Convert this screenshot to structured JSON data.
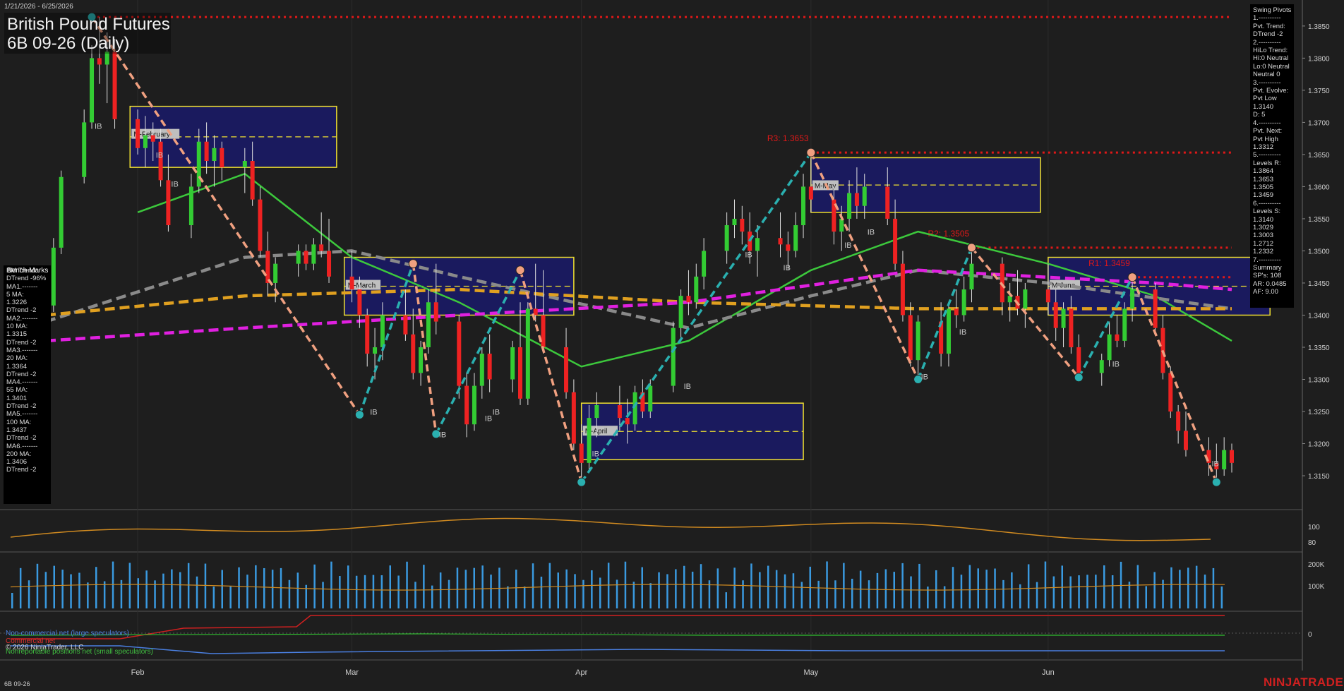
{
  "header": {
    "date_range": "1/21/2026 - 6/25/2026",
    "title_line1": "British Pound Futures",
    "title_line2": "6B 09-26 (Daily)"
  },
  "footer": {
    "symbol": "6B 09-26",
    "brand": "NINJATRADER",
    "copyright": "© 2026 NinjaTrader, LLC"
  },
  "swing_panel": [
    "Swing Pivots",
    "1.----------",
    "Pvt. Trend:",
    "DTrend -2",
    "2.----------",
    "HiLo Trend:",
    "Hi:0 Neutral",
    "Lo:0 Neutral",
    "Neutral 0",
    "3.----------",
    "Pvt. Evolve:",
    "Pvt Low",
    "1.3140",
    "D: 5",
    "4.----------",
    "Pvt. Next:",
    "Pvt High",
    "1.3312",
    "5.----------",
    "Levels R:",
    "1.3864",
    "1.3653",
    "1.3505",
    "1.3459",
    "6.----------",
    "Levels S:",
    "1.3140",
    "1.3029",
    "1.3003",
    "1.2712",
    "1.2332",
    "7.----------",
    "Summary",
    "SP's: 108",
    "AR: 0.0485",
    "AF: 9.00"
  ],
  "ma_panel": {
    "bench_label": "Bench Marks",
    "lines": [
      "BM Trend:",
      "DTrend -96%",
      "MA1.-------",
      "5 MA:",
      "1.3226",
      "DTrend -2",
      "MA2.-------",
      "10 MA:",
      "1.3315",
      "DTrend -2",
      "MA3.-------",
      "20 MA:",
      "1.3364",
      "DTrend -2",
      "MA4.-------",
      "55 MA:",
      "1.3401",
      "DTrend -2",
      "MA5.-------",
      "100 MA:",
      "1.3437",
      "DTrend -2",
      "MA6.-------",
      "200 MA:",
      "1.3406",
      "DTrend -2"
    ]
  },
  "legend": {
    "noncommercial": "Non-commercial net (large speculators)",
    "commercial": "Commercial net",
    "nonreportable": "Nonreportable positions net (small speculators)"
  },
  "colors": {
    "background": "#1e1e1e",
    "up_candle": "#33cc33",
    "down_candle": "#ee2222",
    "ma_green": "#3cc83c",
    "ma_gray": "#8a8a8a",
    "ma_orange": "#e0a020",
    "ma_magenta": "#e020e0",
    "swing_up": "#2ab0b0",
    "swing_down": "#f0a080",
    "resistance": "#e01818",
    "period_box": "#1a1a6a",
    "period_border": "#f0e030",
    "volume": "#3a9ae0",
    "oscillator": "#d08a20"
  },
  "chart_data": {
    "type": "candlestick",
    "y_axis_ticks": [
      "1.3850",
      "1.3800",
      "1.3750",
      "1.3700",
      "1.3650",
      "1.3600",
      "1.3550",
      "1.3500",
      "1.3450",
      "1.3400",
      "1.3350",
      "1.3300",
      "1.3250",
      "1.3200",
      "1.3150"
    ],
    "ylim": [
      1.3105,
      1.3885
    ],
    "x_tick_labels": [
      {
        "label": "Feb",
        "date": "2026-02-02"
      },
      {
        "label": "Mar",
        "date": "2026-03-02"
      },
      {
        "label": "Apr",
        "date": "2026-04-01"
      },
      {
        "label": "May",
        "date": "2026-05-01"
      },
      {
        "label": "Jun",
        "date": "2026-06-01"
      }
    ],
    "x_range": [
      "2026-01-21",
      "2026-06-25"
    ],
    "candles": [
      [
        "2026-01-21",
        1.337,
        1.3425,
        1.336,
        1.3415
      ],
      [
        "2026-01-22",
        1.3415,
        1.352,
        1.3405,
        1.3505
      ],
      [
        "2026-01-23",
        1.3505,
        1.3625,
        1.3495,
        1.3615
      ],
      [
        "2026-01-26",
        1.3615,
        1.372,
        1.3605,
        1.37
      ],
      [
        "2026-01-27",
        1.37,
        1.382,
        1.369,
        1.38
      ],
      [
        "2026-01-28",
        1.38,
        1.3864,
        1.376,
        1.379
      ],
      [
        "2026-01-29",
        1.379,
        1.384,
        1.373,
        1.381
      ],
      [
        "2026-01-30",
        1.381,
        1.383,
        1.369,
        1.3705
      ],
      [
        "2026-02-02",
        1.3705,
        1.372,
        1.365,
        1.366
      ],
      [
        "2026-02-03",
        1.366,
        1.371,
        1.363,
        1.368
      ],
      [
        "2026-02-04",
        1.368,
        1.37,
        1.364,
        1.367
      ],
      [
        "2026-02-05",
        1.367,
        1.369,
        1.36,
        1.361
      ],
      [
        "2026-02-06",
        1.361,
        1.365,
        1.353,
        1.354
      ],
      [
        "2026-02-09",
        1.354,
        1.362,
        1.352,
        1.36
      ],
      [
        "2026-02-10",
        1.36,
        1.369,
        1.359,
        1.367
      ],
      [
        "2026-02-11",
        1.367,
        1.37,
        1.362,
        1.364
      ],
      [
        "2026-02-12",
        1.364,
        1.368,
        1.36,
        1.366
      ],
      [
        "2026-02-13",
        1.366,
        1.367,
        1.361,
        1.363
      ],
      [
        "2026-02-16",
        1.363,
        1.366,
        1.359,
        1.364
      ],
      [
        "2026-02-17",
        1.364,
        1.367,
        1.357,
        1.358
      ],
      [
        "2026-02-18",
        1.358,
        1.36,
        1.349,
        1.35
      ],
      [
        "2026-02-19",
        1.35,
        1.353,
        1.343,
        1.345
      ],
      [
        "2026-02-20",
        1.345,
        1.349,
        1.342,
        1.348
      ],
      [
        "2026-02-23",
        1.348,
        1.351,
        1.346,
        1.35
      ],
      [
        "2026-02-24",
        1.35,
        1.351,
        1.347,
        1.348
      ],
      [
        "2026-02-25",
        1.348,
        1.352,
        1.347,
        1.351
      ],
      [
        "2026-02-26",
        1.351,
        1.356,
        1.349,
        1.35
      ],
      [
        "2026-02-27",
        1.35,
        1.355,
        1.345,
        1.346
      ],
      [
        "2026-03-02",
        1.346,
        1.35,
        1.342,
        1.344
      ],
      [
        "2026-03-03",
        1.344,
        1.346,
        1.338,
        1.34
      ],
      [
        "2026-03-04",
        1.34,
        1.341,
        1.332,
        1.334
      ],
      [
        "2026-03-05",
        1.334,
        1.338,
        1.33,
        1.335
      ],
      [
        "2026-03-06",
        1.335,
        1.342,
        1.333,
        1.34
      ],
      [
        "2026-03-09",
        1.34,
        1.344,
        1.336,
        1.337
      ],
      [
        "2026-03-10",
        1.337,
        1.341,
        1.33,
        1.331
      ],
      [
        "2026-03-11",
        1.331,
        1.336,
        1.329,
        1.335
      ],
      [
        "2026-03-12",
        1.335,
        1.344,
        1.334,
        1.342
      ],
      [
        "2026-03-13",
        1.342,
        1.348,
        1.337,
        1.339
      ],
      [
        "2026-03-16",
        1.339,
        1.34,
        1.327,
        1.329
      ],
      [
        "2026-03-17",
        1.329,
        1.331,
        1.321,
        1.323
      ],
      [
        "2026-03-18",
        1.323,
        1.331,
        1.322,
        1.329
      ],
      [
        "2026-03-19",
        1.329,
        1.335,
        1.327,
        1.334
      ],
      [
        "2026-03-20",
        1.334,
        1.337,
        1.328,
        1.33
      ],
      [
        "2026-03-23",
        1.33,
        1.336,
        1.328,
        1.335
      ],
      [
        "2026-03-24",
        1.335,
        1.342,
        1.326,
        1.327
      ],
      [
        "2026-03-25",
        1.327,
        1.342,
        1.326,
        1.341
      ],
      [
        "2026-03-26",
        1.341,
        1.348,
        1.339,
        1.34
      ],
      [
        "2026-03-27",
        1.34,
        1.347,
        1.334,
        1.335
      ],
      [
        "2026-03-30",
        1.335,
        1.338,
        1.327,
        1.328
      ],
      [
        "2026-03-31",
        1.328,
        1.33,
        1.319,
        1.32
      ],
      [
        "2026-04-01",
        1.32,
        1.323,
        1.314,
        1.317
      ],
      [
        "2026-04-02",
        1.317,
        1.326,
        1.316,
        1.324
      ],
      [
        "2026-04-03",
        1.324,
        1.328,
        1.321,
        1.326
      ],
      [
        "2026-04-06",
        1.326,
        1.329,
        1.322,
        1.324
      ],
      [
        "2026-04-07",
        1.324,
        1.327,
        1.32,
        1.323
      ],
      [
        "2026-04-08",
        1.323,
        1.329,
        1.322,
        1.328
      ],
      [
        "2026-04-09",
        1.328,
        1.33,
        1.324,
        1.325
      ],
      [
        "2026-04-10",
        1.325,
        1.33,
        1.324,
        1.329
      ],
      [
        "2026-04-13",
        1.329,
        1.339,
        1.328,
        1.338
      ],
      [
        "2026-04-14",
        1.338,
        1.344,
        1.336,
        1.343
      ],
      [
        "2026-04-15",
        1.343,
        1.347,
        1.34,
        1.342
      ],
      [
        "2026-04-16",
        1.342,
        1.348,
        1.341,
        1.346
      ],
      [
        "2026-04-17",
        1.346,
        1.352,
        1.344,
        1.35
      ],
      [
        "2026-04-20",
        1.35,
        1.356,
        1.348,
        1.354
      ],
      [
        "2026-04-21",
        1.354,
        1.358,
        1.352,
        1.355
      ],
      [
        "2026-04-22",
        1.355,
        1.357,
        1.351,
        1.353
      ],
      [
        "2026-04-23",
        1.353,
        1.356,
        1.348,
        1.35
      ],
      [
        "2026-04-24",
        1.35,
        1.354,
        1.346,
        1.352
      ],
      [
        "2026-04-27",
        1.352,
        1.356,
        1.349,
        1.351
      ],
      [
        "2026-04-28",
        1.351,
        1.353,
        1.347,
        1.35
      ],
      [
        "2026-04-29",
        1.35,
        1.356,
        1.349,
        1.354
      ],
      [
        "2026-04-30",
        1.354,
        1.362,
        1.352,
        1.36
      ],
      [
        "2026-05-01",
        1.36,
        1.3653,
        1.356,
        1.358
      ],
      [
        "2026-05-04",
        1.358,
        1.36,
        1.351,
        1.353
      ],
      [
        "2026-05-05",
        1.353,
        1.357,
        1.35,
        1.355
      ],
      [
        "2026-05-06",
        1.355,
        1.361,
        1.353,
        1.359
      ],
      [
        "2026-05-07",
        1.359,
        1.363,
        1.355,
        1.357
      ],
      [
        "2026-05-08",
        1.357,
        1.362,
        1.355,
        1.36
      ],
      [
        "2026-05-11",
        1.36,
        1.363,
        1.354,
        1.355
      ],
      [
        "2026-05-12",
        1.355,
        1.358,
        1.347,
        1.348
      ],
      [
        "2026-05-13",
        1.348,
        1.35,
        1.339,
        1.34
      ],
      [
        "2026-05-14",
        1.34,
        1.342,
        1.332,
        1.333
      ],
      [
        "2026-05-15",
        1.333,
        1.34,
        1.33,
        1.339
      ],
      [
        "2026-05-18",
        1.339,
        1.342,
        1.332,
        1.334
      ],
      [
        "2026-05-19",
        1.334,
        1.342,
        1.332,
        1.341
      ],
      [
        "2026-05-20",
        1.341,
        1.344,
        1.338,
        1.34
      ],
      [
        "2026-05-21",
        1.34,
        1.346,
        1.339,
        1.344
      ],
      [
        "2026-05-22",
        1.344,
        1.3505,
        1.342,
        1.348
      ],
      [
        "2026-05-26",
        1.348,
        1.349,
        1.34,
        1.342
      ],
      [
        "2026-05-27",
        1.342,
        1.345,
        1.339,
        1.343
      ],
      [
        "2026-05-28",
        1.343,
        1.347,
        1.34,
        1.341
      ],
      [
        "2026-05-29",
        1.341,
        1.345,
        1.338,
        1.344
      ],
      [
        "2026-06-01",
        1.344,
        1.348,
        1.34,
        1.342
      ],
      [
        "2026-06-02",
        1.342,
        1.344,
        1.336,
        1.338
      ],
      [
        "2026-06-03",
        1.338,
        1.342,
        1.335,
        1.341
      ],
      [
        "2026-06-04",
        1.341,
        1.343,
        1.334,
        1.335
      ],
      [
        "2026-06-05",
        1.335,
        1.337,
        1.33,
        1.331
      ],
      [
        "2026-06-08",
        1.331,
        1.334,
        1.329,
        1.333
      ],
      [
        "2026-06-09",
        1.333,
        1.339,
        1.332,
        1.337
      ],
      [
        "2026-06-10",
        1.337,
        1.34,
        1.335,
        1.336
      ],
      [
        "2026-06-11",
        1.336,
        1.342,
        1.335,
        1.341
      ],
      [
        "2026-06-12",
        1.341,
        1.3459,
        1.339,
        1.344
      ],
      [
        "2026-06-15",
        1.344,
        1.345,
        1.337,
        1.338
      ],
      [
        "2026-06-16",
        1.338,
        1.34,
        1.33,
        1.331
      ],
      [
        "2026-06-17",
        1.331,
        1.332,
        1.324,
        1.325
      ],
      [
        "2026-06-18",
        1.325,
        1.326,
        1.32,
        1.322
      ],
      [
        "2026-06-19",
        1.322,
        1.325,
        1.318,
        1.319
      ],
      [
        "2026-06-22",
        1.319,
        1.321,
        1.315,
        1.317
      ],
      [
        "2026-06-23",
        1.317,
        1.32,
        1.314,
        1.316
      ],
      [
        "2026-06-24",
        1.316,
        1.321,
        1.315,
        1.319
      ],
      [
        "2026-06-25",
        1.319,
        1.32,
        1.3155,
        1.317
      ]
    ],
    "moving_averages": [
      {
        "color": "green",
        "points": [
          [
            "2026-02-02",
            1.356
          ],
          [
            "2026-02-16",
            1.362
          ],
          [
            "2026-03-02",
            1.349
          ],
          [
            "2026-03-16",
            1.342
          ],
          [
            "2026-04-01",
            1.332
          ],
          [
            "2026-04-15",
            1.336
          ],
          [
            "2026-05-01",
            1.347
          ],
          [
            "2026-05-15",
            1.353
          ],
          [
            "2026-06-01",
            1.348
          ],
          [
            "2026-06-15",
            1.343
          ],
          [
            "2026-06-25",
            1.336
          ]
        ]
      },
      {
        "color": "gray",
        "points": [
          [
            "2026-01-21",
            1.339
          ],
          [
            "2026-02-16",
            1.349
          ],
          [
            "2026-03-02",
            1.35
          ],
          [
            "2026-03-16",
            1.346
          ],
          [
            "2026-04-15",
            1.338
          ],
          [
            "2026-05-01",
            1.343
          ],
          [
            "2026-05-15",
            1.347
          ],
          [
            "2026-06-01",
            1.345
          ],
          [
            "2026-06-25",
            1.341
          ]
        ]
      },
      {
        "color": "orange",
        "points": [
          [
            "2026-01-21",
            1.34
          ],
          [
            "2026-02-16",
            1.343
          ],
          [
            "2026-03-16",
            1.344
          ],
          [
            "2026-04-15",
            1.342
          ],
          [
            "2026-05-15",
            1.341
          ],
          [
            "2026-06-15",
            1.341
          ],
          [
            "2026-06-25",
            1.341
          ]
        ]
      },
      {
        "color": "magenta",
        "points": [
          [
            "2026-01-21",
            1.336
          ],
          [
            "2026-02-16",
            1.338
          ],
          [
            "2026-03-16",
            1.34
          ],
          [
            "2026-04-15",
            1.342
          ],
          [
            "2026-05-15",
            1.347
          ],
          [
            "2026-06-15",
            1.345
          ],
          [
            "2026-06-25",
            1.344
          ]
        ]
      }
    ],
    "swing_points": [
      [
        "2026-01-27",
        1.3864
      ],
      [
        "2026-03-03",
        1.3245
      ],
      [
        "2026-03-10",
        1.348
      ],
      [
        "2026-03-13",
        1.3215
      ],
      [
        "2026-03-24",
        1.347
      ],
      [
        "2026-04-01",
        1.314
      ],
      [
        "2026-05-01",
        1.3653
      ],
      [
        "2026-05-15",
        1.33
      ],
      [
        "2026-05-22",
        1.3505
      ],
      [
        "2026-06-05",
        1.3303
      ],
      [
        "2026-06-12",
        1.3459
      ],
      [
        "2026-06-23",
        1.314
      ]
    ],
    "resistance_levels": [
      {
        "label": "",
        "value": 1.3864
      },
      {
        "label": "R3: 1.3653",
        "value": 1.3653
      },
      {
        "label": "R2: 1.3505",
        "value": 1.3505
      },
      {
        "label": "R1: 1.3459",
        "value": 1.3459
      }
    ],
    "period_boxes": [
      {
        "label": "M-February",
        "start": "2026-02-01",
        "end": "2026-02-28",
        "high": 1.3725,
        "low": 1.363
      },
      {
        "label": "M-March",
        "start": "2026-03-01",
        "end": "2026-03-31",
        "high": 1.349,
        "low": 1.34
      },
      {
        "label": "M-April",
        "start": "2026-04-01",
        "end": "2026-04-30",
        "high": 1.3263,
        "low": 1.3175
      },
      {
        "label": "M-May",
        "start": "2026-05-01",
        "end": "2026-05-31",
        "high": 1.3645,
        "low": 1.356
      },
      {
        "label": "M-June",
        "start": "2026-06-01",
        "end": "2026-06-30",
        "high": 1.349,
        "low": 1.34
      }
    ],
    "ib_labels": [
      [
        "2026-01-27",
        1.369
      ],
      [
        "2026-02-04",
        1.3645
      ],
      [
        "2026-02-06",
        1.36
      ],
      [
        "2026-03-04",
        1.3245
      ],
      [
        "2026-03-13",
        1.321
      ],
      [
        "2026-03-19",
        1.3235
      ],
      [
        "2026-03-20",
        1.3245
      ],
      [
        "2026-04-02",
        1.318
      ],
      [
        "2026-04-14",
        1.3285
      ],
      [
        "2026-04-22",
        1.349
      ],
      [
        "2026-04-27",
        1.347
      ],
      [
        "2026-05-05",
        1.3505
      ],
      [
        "2026-05-08",
        1.3525
      ],
      [
        "2026-05-15",
        1.33
      ],
      [
        "2026-05-20",
        1.337
      ],
      [
        "2026-06-09",
        1.332
      ],
      [
        "2026-06-22",
        1.3165
      ]
    ],
    "oscillator_ticks": [
      "100",
      "80"
    ],
    "volume_ticks": [
      "200K",
      "100K"
    ],
    "cot_ticks": [
      "0"
    ]
  }
}
